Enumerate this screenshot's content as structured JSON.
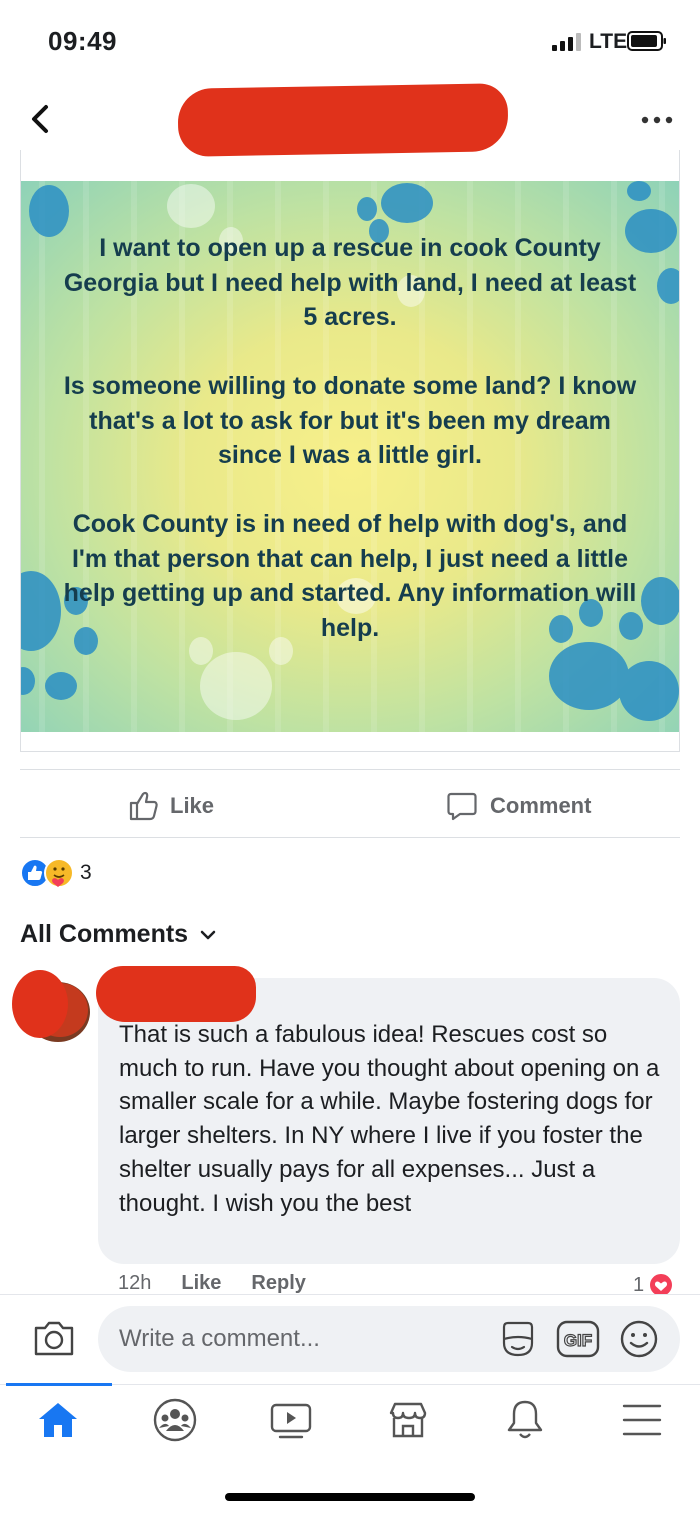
{
  "status_bar": {
    "time": "09:49",
    "network": "LTE"
  },
  "post": {
    "image_text": "I want to open up a rescue in cook County Georgia but I need help with land, I need at least 5 acres.\n\nIs someone willing to donate some land? I know that's a lot to ask for but it's been my dream since I was a little girl.\n\nCook County is in need of help with dog's, and I'm that person that can help, I just need a little help getting up and started. Any information will help.",
    "colors": {
      "text": "#153d4e",
      "paw": "#2b8fc4"
    }
  },
  "actions": {
    "like_label": "Like",
    "comment_label": "Comment"
  },
  "reactions": {
    "count": "3",
    "icons": [
      "like-icon",
      "care-icon"
    ]
  },
  "comments_filter": {
    "label": "All Comments"
  },
  "comment": {
    "text": "That is such a fabulous idea!  Rescues cost so much to run.  Have you thought about opening on a smaller scale for a while. Maybe fostering dogs for larger shelters.   In NY where I live if you foster the shelter usually pays for all expenses... Just a thought.  I wish you the best",
    "time": "12h",
    "like_label": "Like",
    "reply_label": "Reply",
    "reaction_count": "1"
  },
  "composer": {
    "placeholder": "Write a comment..."
  },
  "tabs": [
    "home-icon",
    "groups-icon",
    "watch-icon",
    "marketplace-icon",
    "notifications-icon",
    "menu-icon"
  ],
  "colors": {
    "accent": "#1877f2",
    "redaction": "#e0321b"
  }
}
